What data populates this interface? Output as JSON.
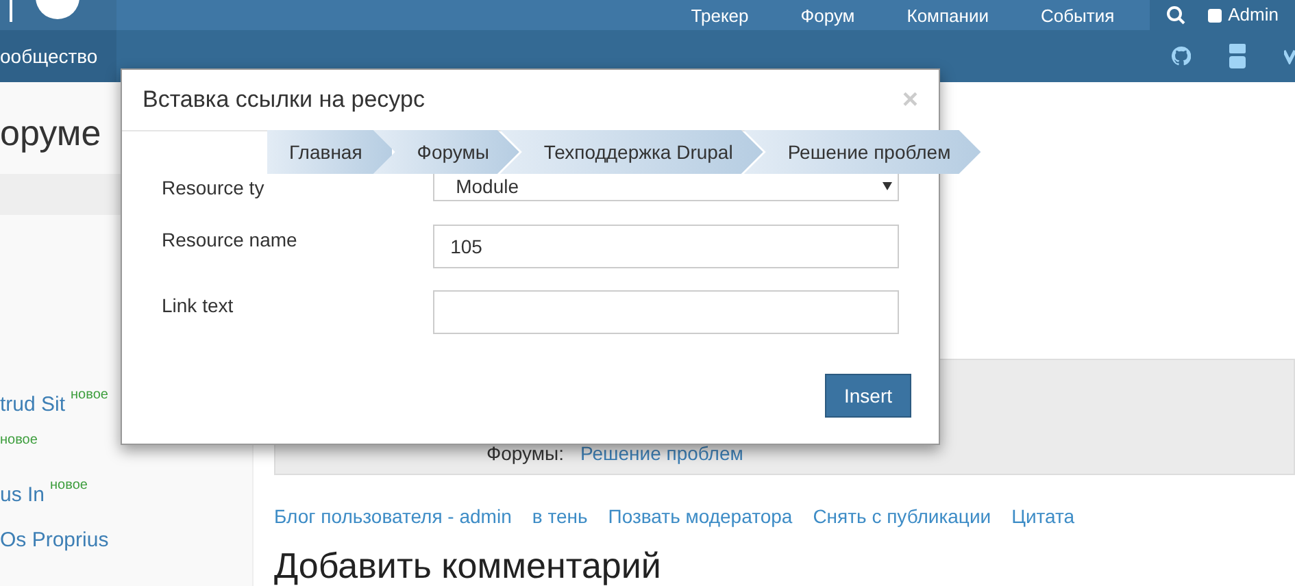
{
  "top_nav": {
    "items": [
      "Трекер",
      "Форум",
      "Компании",
      "События"
    ],
    "user": "Admin"
  },
  "sub_nav": {
    "tab": "ообщество"
  },
  "sidebar": {
    "heading": "оруме",
    "items": [
      {
        "label": "trud Sit",
        "badge": "новое"
      },
      {
        "badge": "новое"
      },
      {
        "label": "us In",
        "badge": "новое"
      },
      {
        "label": "Os Proprius"
      }
    ]
  },
  "info_box": {
    "label": "Форумы:",
    "link": "Решение проблем"
  },
  "links": [
    "Блог пользователя - admin",
    "в тень",
    "Позвать модератора",
    "Снять с публикации",
    "Цитата"
  ],
  "comment_heading": "Добавить комментарий",
  "breadcrumb": [
    "Главная",
    "Форумы",
    "Техподдержка Drupal",
    "Решение проблем"
  ],
  "dialog": {
    "title": "Вставка ссылки на ресурс",
    "close": "×",
    "fields": [
      {
        "kind": "select",
        "label": "Resource ty",
        "value": "Module"
      },
      {
        "kind": "text",
        "label": "Resource name",
        "value": "105"
      },
      {
        "kind": "text",
        "label": "Link text"
      }
    ],
    "button": "Insert"
  }
}
